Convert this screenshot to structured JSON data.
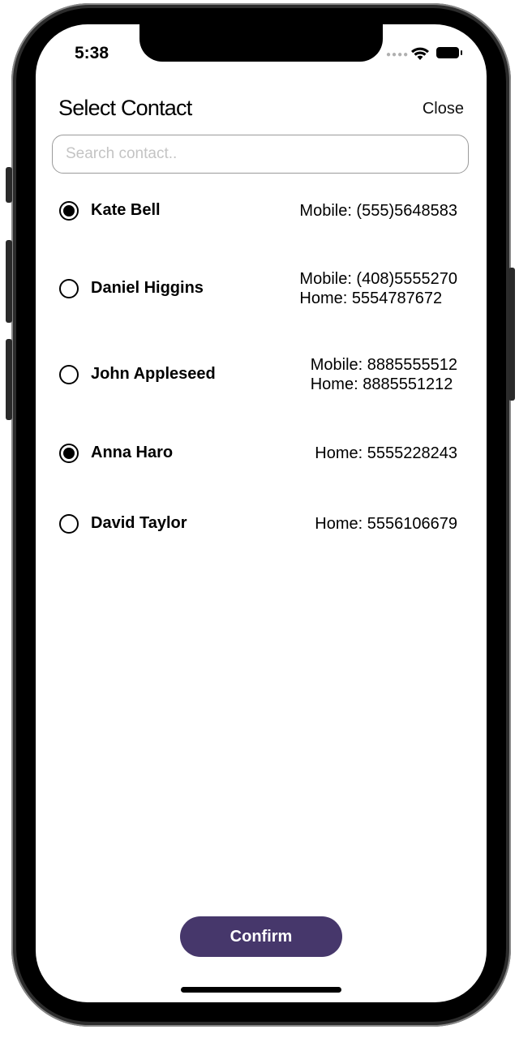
{
  "status_bar": {
    "time": "5:38",
    "icons": [
      "signal-dots-icon",
      "wifi-icon",
      "battery-icon"
    ]
  },
  "header": {
    "title": "Select Contact",
    "close_label": "Close"
  },
  "search": {
    "placeholder": "Search contact..",
    "value": ""
  },
  "contacts": [
    {
      "name": "Kate Bell",
      "selected": true,
      "phones": [
        "Mobile: (555)5648583"
      ]
    },
    {
      "name": "Daniel Higgins",
      "selected": false,
      "phones": [
        "Mobile: (408)5555270",
        "Home: 5554787672"
      ]
    },
    {
      "name": "John Appleseed",
      "selected": false,
      "phones": [
        "Mobile: 8885555512",
        "Home: 8885551212"
      ]
    },
    {
      "name": "Anna Haro",
      "selected": true,
      "phones": [
        "Home: 5555228243"
      ]
    },
    {
      "name": "David Taylor",
      "selected": false,
      "phones": [
        "Home: 5556106679"
      ]
    }
  ],
  "footer": {
    "confirm_label": "Confirm"
  },
  "colors": {
    "accent": "#46376b",
    "text": "#000000",
    "placeholder": "#c4c4c4",
    "border": "#9a9a9a"
  }
}
